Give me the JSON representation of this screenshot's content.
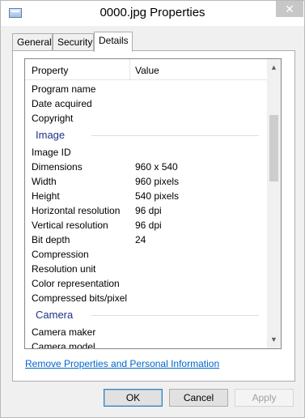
{
  "window": {
    "title": "0000.jpg Properties",
    "close_glyph": "✕"
  },
  "tabs": [
    {
      "label": "General"
    },
    {
      "label": "Security"
    },
    {
      "label": "Details"
    }
  ],
  "details": {
    "columns": {
      "property": "Property",
      "value": "Value"
    },
    "rows_top": [
      {
        "property": "Program name",
        "value": ""
      },
      {
        "property": "Date acquired",
        "value": ""
      },
      {
        "property": "Copyright",
        "value": ""
      }
    ],
    "group_image": "Image",
    "rows_image": [
      {
        "property": "Image ID",
        "value": ""
      },
      {
        "property": "Dimensions",
        "value": "960 x 540"
      },
      {
        "property": "Width",
        "value": "960 pixels"
      },
      {
        "property": "Height",
        "value": "540 pixels"
      },
      {
        "property": "Horizontal resolution",
        "value": "96 dpi"
      },
      {
        "property": "Vertical resolution",
        "value": "96 dpi"
      },
      {
        "property": "Bit depth",
        "value": "24"
      },
      {
        "property": "Compression",
        "value": ""
      },
      {
        "property": "Resolution unit",
        "value": ""
      },
      {
        "property": "Color representation",
        "value": ""
      },
      {
        "property": "Compressed bits/pixel",
        "value": ""
      }
    ],
    "group_camera": "Camera",
    "rows_camera": [
      {
        "property": "Camera maker",
        "value": ""
      },
      {
        "property": "Camera model",
        "value": ""
      }
    ]
  },
  "links": {
    "remove_properties": "Remove Properties and Personal Information"
  },
  "buttons": {
    "ok": "OK",
    "cancel": "Cancel",
    "apply": "Apply"
  },
  "icons": {
    "scroll_up": "▲",
    "scroll_down": "▼"
  }
}
